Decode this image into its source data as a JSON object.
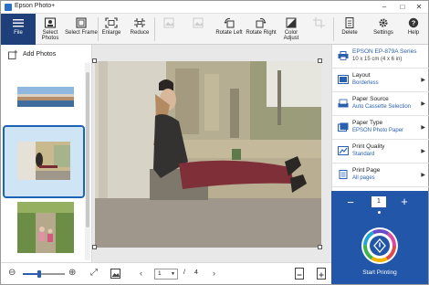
{
  "app": {
    "title": "Epson Photo+"
  },
  "toolbar": {
    "file": "File",
    "select_photos": "Select Photos",
    "select_frame": "Select Frame",
    "enlarge": "Enlarge",
    "reduce": "Reduce",
    "rotate_left": "Rotate Left",
    "rotate_right": "Rotate Right",
    "color_adjust": "Color Adjust",
    "delete": "Delete",
    "settings": "Settings",
    "help": "Help"
  },
  "sidebar": {
    "add_photos": "Add Photos"
  },
  "settings_panel": {
    "printer": {
      "name": "EPSON EP-879A Series",
      "paper_size": "10 x 15 cm (4 x 6 in)"
    },
    "layout": {
      "label": "Layout",
      "value": "Borderless"
    },
    "paper_source": {
      "label": "Paper Source",
      "value": "Auto Cassette Selection"
    },
    "paper_type": {
      "label": "Paper Type",
      "value": "EPSON Photo Paper"
    },
    "print_quality": {
      "label": "Print Quality",
      "value": "Standard"
    },
    "print_page": {
      "label": "Print Page",
      "value": "All pages"
    }
  },
  "print": {
    "copies": "1",
    "button_label": "Start Printing"
  },
  "pagination": {
    "current": "1",
    "separator": "/",
    "total": "4"
  },
  "zoom": {
    "level": 0.4
  },
  "colors": {
    "accent": "#2256a8",
    "selection": "#1e64b4",
    "file_tab": "#1f3f7a"
  }
}
